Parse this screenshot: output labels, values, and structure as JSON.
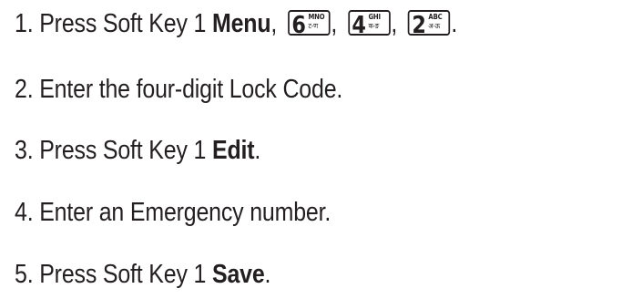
{
  "steps": [
    {
      "number": "1.",
      "text": "Press Soft Key 1 ",
      "bold": "Menu",
      "after": ",",
      "keys": [
        {
          "digit": "6",
          "letters": "MNO",
          "script": "ट-ण",
          "sep": ","
        },
        {
          "digit": "4",
          "letters": "GHI",
          "script": "क-ङ",
          "sep": ","
        },
        {
          "digit": "2",
          "letters": "ABC",
          "script": "अ-ऊ",
          "sep": "."
        }
      ]
    },
    {
      "number": "2.",
      "text": "Enter the four-digit Lock Code.",
      "bold": "",
      "after": ""
    },
    {
      "number": "3.",
      "text": "Press Soft Key 1 ",
      "bold": "Edit",
      "after": "."
    },
    {
      "number": "4.",
      "text": "Enter an Emergency number.",
      "bold": "",
      "after": ""
    },
    {
      "number": "5.",
      "text": "Press Soft Key 1 ",
      "bold": "Save",
      "after": "."
    }
  ]
}
